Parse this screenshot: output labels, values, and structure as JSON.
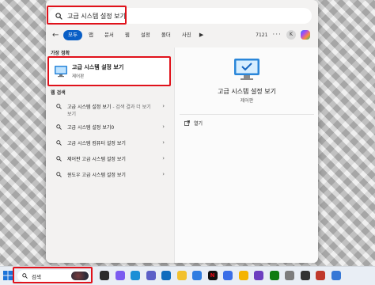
{
  "search": {
    "query": "고급 시스템 설정 보기"
  },
  "filters": {
    "tabs": [
      "모두",
      "앱",
      "문서",
      "웹",
      "설정",
      "폴더",
      "사진"
    ],
    "active_index": 0,
    "count": "7121",
    "avatar_letter": "K"
  },
  "best_match": {
    "section_label": "가장 정확",
    "title": "고급 시스템 설정 보기",
    "subtitle": "제어판"
  },
  "web": {
    "section_label": "웹 검색",
    "items": [
      {
        "text": "고급 시스템 설정 보기",
        "hint": " - 검색 결과 더 보기",
        "line2": "보기"
      },
      {
        "text": "고급 시스템 설정 보기0",
        "hint": "",
        "line2": ""
      },
      {
        "text": "고급 시스템 컴퓨터 설정 보기",
        "hint": "",
        "line2": ""
      },
      {
        "text": "제어판 고급 시스템 설정 보기",
        "hint": "",
        "line2": ""
      },
      {
        "text": "윈도우 고급 시스템 설정 보기",
        "hint": "",
        "line2": ""
      }
    ]
  },
  "detail": {
    "title": "고급 시스템 설정 보기",
    "subtitle": "제어판",
    "open_label": "열기"
  },
  "taskbar": {
    "search_label": "검색",
    "apps": [
      {
        "name": "task-view-icon",
        "color": "#2b2b2b"
      },
      {
        "name": "copilot-icon",
        "color": "#7b5cf0"
      },
      {
        "name": "edge-icon",
        "color": "#1c8fd6"
      },
      {
        "name": "teams-icon",
        "color": "#5b5fc7"
      },
      {
        "name": "outlook-icon",
        "color": "#0f6cbd"
      },
      {
        "name": "file-explorer-icon",
        "color": "#f2c12e"
      },
      {
        "name": "store-icon",
        "color": "#2f7de1"
      },
      {
        "name": "netflix-icon",
        "color": "#e50914",
        "glyph": "N"
      },
      {
        "name": "phone-link-icon",
        "color": "#3a6ee8"
      },
      {
        "name": "chrome-icon",
        "color": "#f4b400"
      },
      {
        "name": "app-icon",
        "color": "#6d3fc0"
      },
      {
        "name": "xbox-icon",
        "color": "#107c10"
      },
      {
        "name": "settings-icon",
        "color": "#7d7d7d"
      },
      {
        "name": "terminal-icon",
        "color": "#333333"
      },
      {
        "name": "app-icon",
        "color": "#c0392b"
      },
      {
        "name": "app-icon",
        "color": "#3778d6"
      }
    ]
  }
}
